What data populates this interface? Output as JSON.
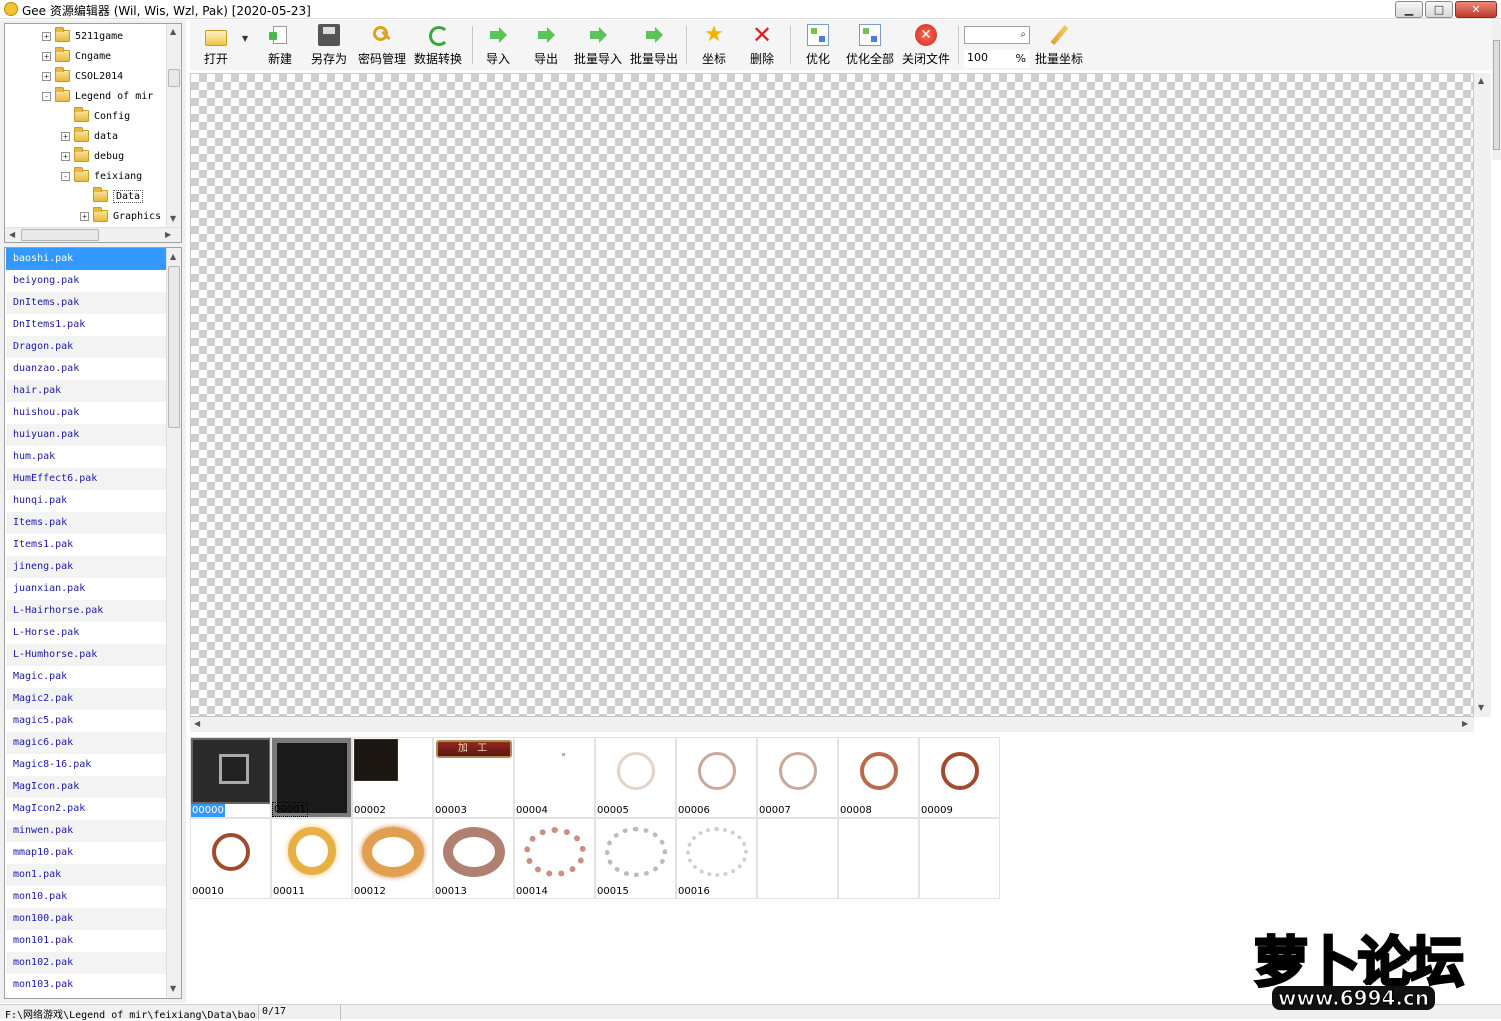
{
  "window": {
    "title": "Gee 资源编辑器 (Wil, Wis, Wzl, Pak) [2020-05-23]"
  },
  "tree": {
    "items": [
      {
        "label": "5211game",
        "level": 2,
        "expander": "+"
      },
      {
        "label": "Cngame",
        "level": 2,
        "expander": "+"
      },
      {
        "label": "CSOL2014",
        "level": 2,
        "expander": "+"
      },
      {
        "label": "Legend of mir",
        "level": 2,
        "expander": "-"
      },
      {
        "label": "Config",
        "level": 3,
        "expander": ""
      },
      {
        "label": "data",
        "level": 3,
        "expander": "+"
      },
      {
        "label": "debug",
        "level": 3,
        "expander": "+"
      },
      {
        "label": "feixiang",
        "level": 3,
        "expander": "-"
      },
      {
        "label": "Data",
        "level": 4,
        "expander": "",
        "selected": true
      },
      {
        "label": "Graphics",
        "level": 4,
        "expander": "+"
      }
    ]
  },
  "files": [
    "baoshi.pak",
    "beiyong.pak",
    "DnItems.pak",
    "DnItems1.pak",
    "Dragon.pak",
    "duanzao.pak",
    "hair.pak",
    "huishou.pak",
    "huiyuan.pak",
    "hum.pak",
    "HumEffect6.pak",
    "hunqi.pak",
    "Items.pak",
    "Items1.pak",
    "jineng.pak",
    "juanxian.pak",
    "L-Hairhorse.pak",
    "L-Horse.pak",
    "L-Humhorse.pak",
    "Magic.pak",
    "Magic2.pak",
    "magic5.pak",
    "magic6.pak",
    "Magic8-16.pak",
    "MagIcon.pak",
    "MagIcon2.pak",
    "minwen.pak",
    "mmap10.pak",
    "mon1.pak",
    "mon10.pak",
    "mon100.pak",
    "mon101.pak",
    "mon102.pak",
    "mon103.pak"
  ],
  "selected_file": "baoshi.pak",
  "toolbar": {
    "open": "打开",
    "new": "新建",
    "save_as": "另存为",
    "password": "密码管理",
    "convert": "数据转换",
    "import": "导入",
    "export": "导出",
    "batch_import": "批量导入",
    "batch_export": "批量导出",
    "coords": "坐标",
    "delete": "删除",
    "optimize": "优化",
    "optimize_all": "优化全部",
    "close_file": "关闭文件",
    "zoom": "100",
    "zoom_unit": "%",
    "batch_coords": "批量坐标"
  },
  "thumbnails": [
    {
      "id": "00000",
      "selected": true
    },
    {
      "id": "00001",
      "boxed": true
    },
    {
      "id": "00002"
    },
    {
      "id": "00003",
      "banner_text": "加 工"
    },
    {
      "id": "00004"
    },
    {
      "id": "00005"
    },
    {
      "id": "00006"
    },
    {
      "id": "00007"
    },
    {
      "id": "00008"
    },
    {
      "id": "00009"
    },
    {
      "id": "00010"
    },
    {
      "id": "00011"
    },
    {
      "id": "00012"
    },
    {
      "id": "00013"
    },
    {
      "id": "00014"
    },
    {
      "id": "00015"
    },
    {
      "id": "00016"
    }
  ],
  "status": {
    "path": "F:\\网络游戏\\Legend of mir\\feixiang\\Data\\baoshi.pak",
    "count": "0/17"
  },
  "watermark": {
    "logo_text": "萝卜论坛",
    "url": "www.6994.cn"
  }
}
